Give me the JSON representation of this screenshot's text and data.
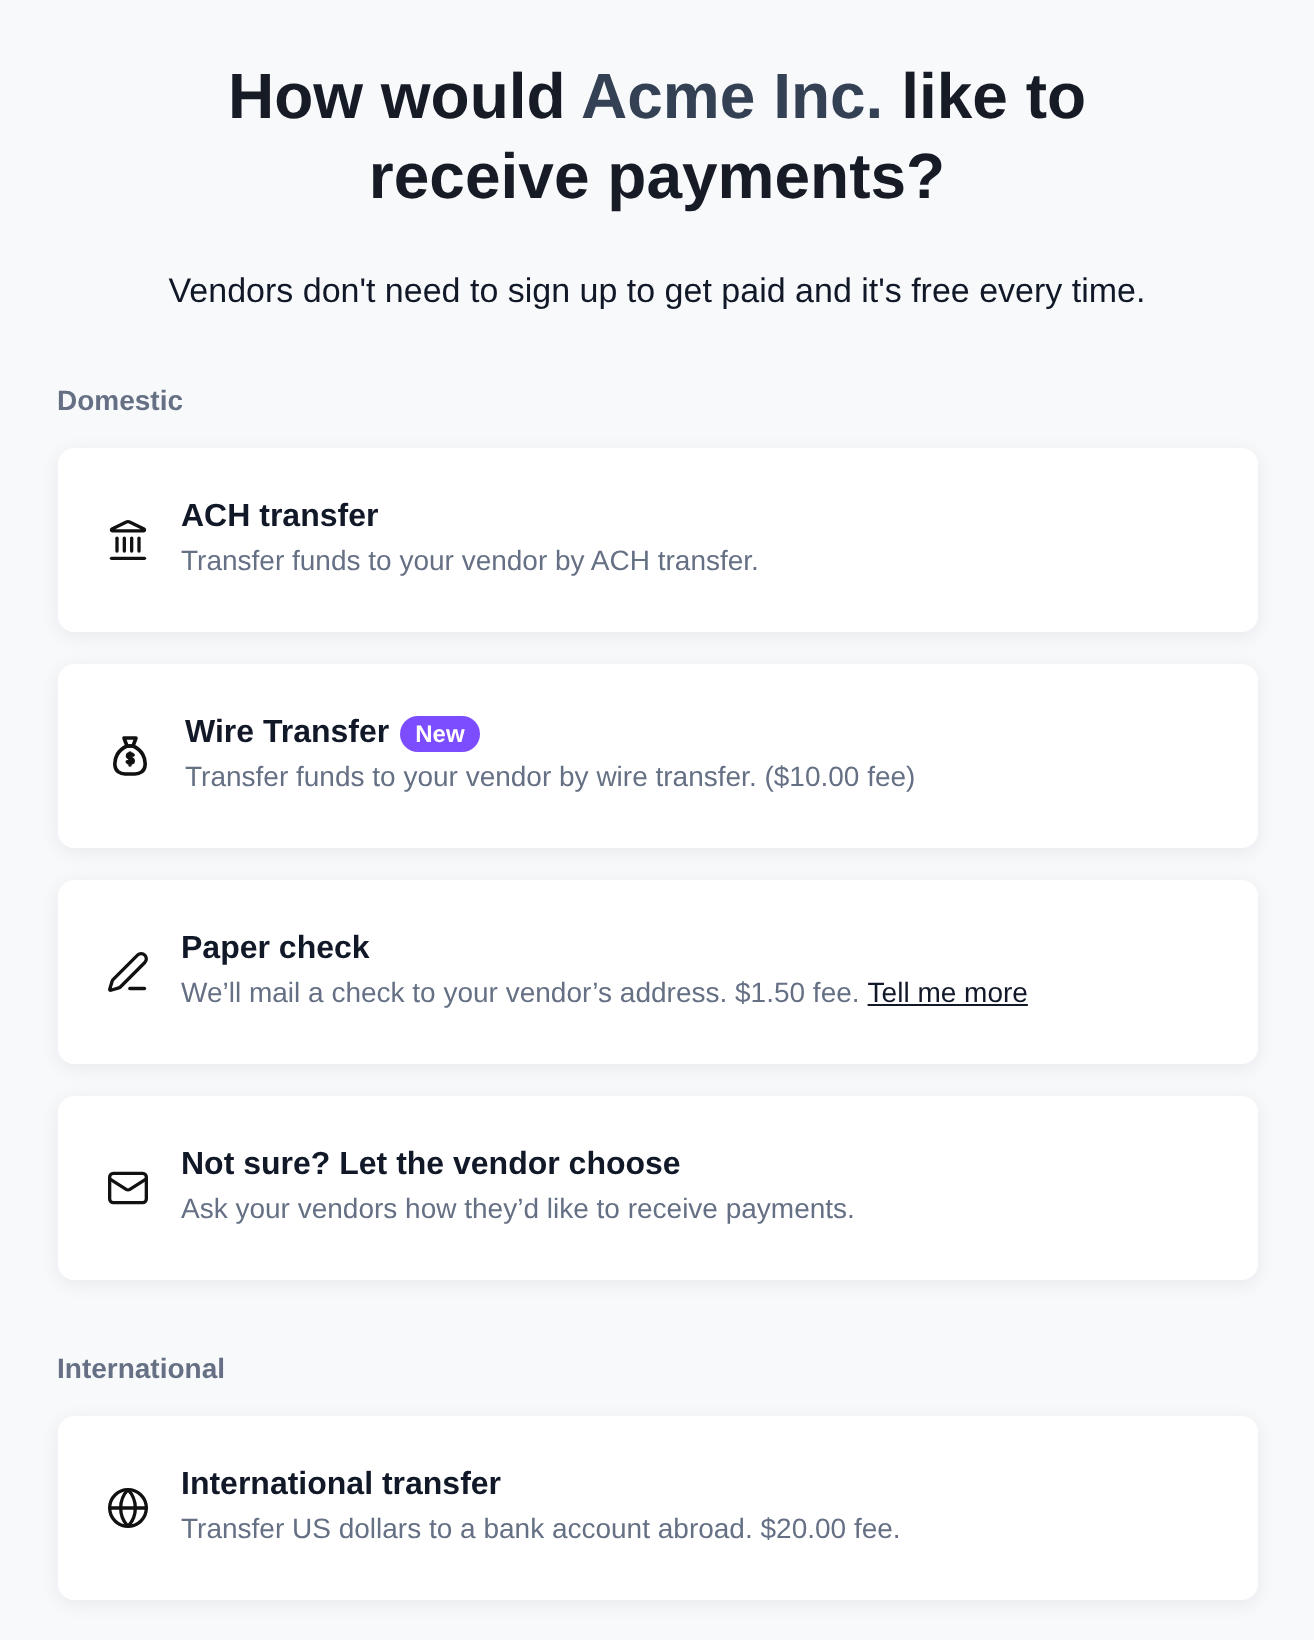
{
  "title": [
    {
      "text": "How would ",
      "highlight": false
    },
    {
      "text": "Acme Inc.",
      "highlight": true
    },
    {
      "text": " like to receive payments?",
      "highlight": false
    }
  ],
  "subtitle": "Vendors don't need to sign up to get paid and it's free every time.",
  "sections": [
    {
      "heading": "Domestic",
      "options": [
        {
          "kind": "ach",
          "name": "ACH transfer",
          "description": "Transfer funds to your vendor by ACH transfer."
        },
        {
          "kind": "wire",
          "name": "Wire Transfer",
          "badge": "New",
          "description": "Transfer funds to your vendor by wire transfer. ($10.00 fee)"
        },
        {
          "kind": "check",
          "name": "Paper check",
          "description": "We’ll mail a check to your vendor’s address. $1.50 fee.",
          "link": "Tell me more"
        },
        {
          "kind": "choose",
          "name": "Not sure? Let the vendor choose",
          "description": "Ask your vendors how they’d like to receive payments."
        }
      ]
    },
    {
      "heading": "International",
      "options": [
        {
          "kind": "international",
          "name": "International transfer",
          "description": "Transfer US dollars to a bank account abroad. $20.00 fee."
        }
      ]
    }
  ]
}
